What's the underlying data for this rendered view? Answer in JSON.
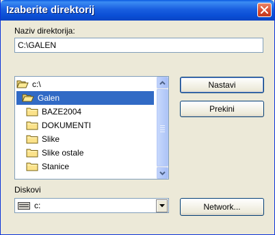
{
  "dialog": {
    "title": "Izaberite direktorij"
  },
  "dir_name": {
    "label": "Naziv direktorija:",
    "value": "C:\\GALEN"
  },
  "dir_list": {
    "items": [
      {
        "label": "c:\\",
        "icon": "open-folder-icon",
        "selected": false
      },
      {
        "label": "Galen",
        "icon": "open-folder-icon",
        "selected": true
      },
      {
        "label": "BAZE2004",
        "icon": "folder-icon",
        "selected": false
      },
      {
        "label": "DOKUMENTI",
        "icon": "folder-icon",
        "selected": false
      },
      {
        "label": "Slike",
        "icon": "folder-icon",
        "selected": false
      },
      {
        "label": "Slike ostale",
        "icon": "folder-icon",
        "selected": false
      },
      {
        "label": "Stanice",
        "icon": "folder-icon",
        "selected": false
      }
    ]
  },
  "buttons": {
    "continue": "Nastavi",
    "cancel": "Prekini",
    "network": "Network..."
  },
  "drives": {
    "label": "Diskovi",
    "selected": "c:",
    "icon": "drive-icon"
  },
  "colors": {
    "title_bar": "#0a4fd6",
    "selection": "#316ac5",
    "close_button": "#d6482c"
  }
}
